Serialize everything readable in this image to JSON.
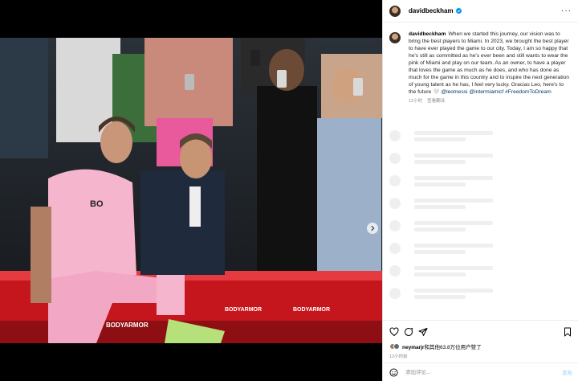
{
  "post": {
    "username": "davidbeckham",
    "header_more_icon": "more-horizontal-icon",
    "caption_text": "When we started this journey, our vision was to bring the best players to Miami. In 2023, we brought the best player to have ever played the game to our city. Today, I am so happy that he's still as committed as he's ever been and still wants to wear the pink of Miami and play on our team. As an owner, to have a player that loves the game as much as he does, and who has done as much for the game in this country and to inspire the next generation of young talent as he has, I feel very lucky. Gracias Leo, here's to the future 🤍",
    "mention_1": "@leomessi",
    "mention_2": "@intermiamicf",
    "hashtag": "#FreedomToDream",
    "time_ago": "12小时",
    "see_translation": "查看翻译",
    "likes_user": "neymarjr",
    "likes_rest": "和其他63.8万位用户赞了",
    "post_age": "12小时前",
    "comment_placeholder": "添加评论...",
    "post_button": "发布"
  },
  "icons": {
    "like": "heart-icon",
    "comment": "comment-icon",
    "share": "send-icon",
    "save": "bookmark-icon",
    "emoji": "emoji-icon",
    "verified": "verified-badge-icon",
    "carousel_next": "chevron-right-icon"
  },
  "colors": {
    "verified": "#0095f6",
    "link": "#00376b",
    "muted": "#8e8e8e",
    "post_button": "#b2dffc",
    "jersey_pink": "#f5b6cd"
  },
  "skeleton_rows": 8
}
